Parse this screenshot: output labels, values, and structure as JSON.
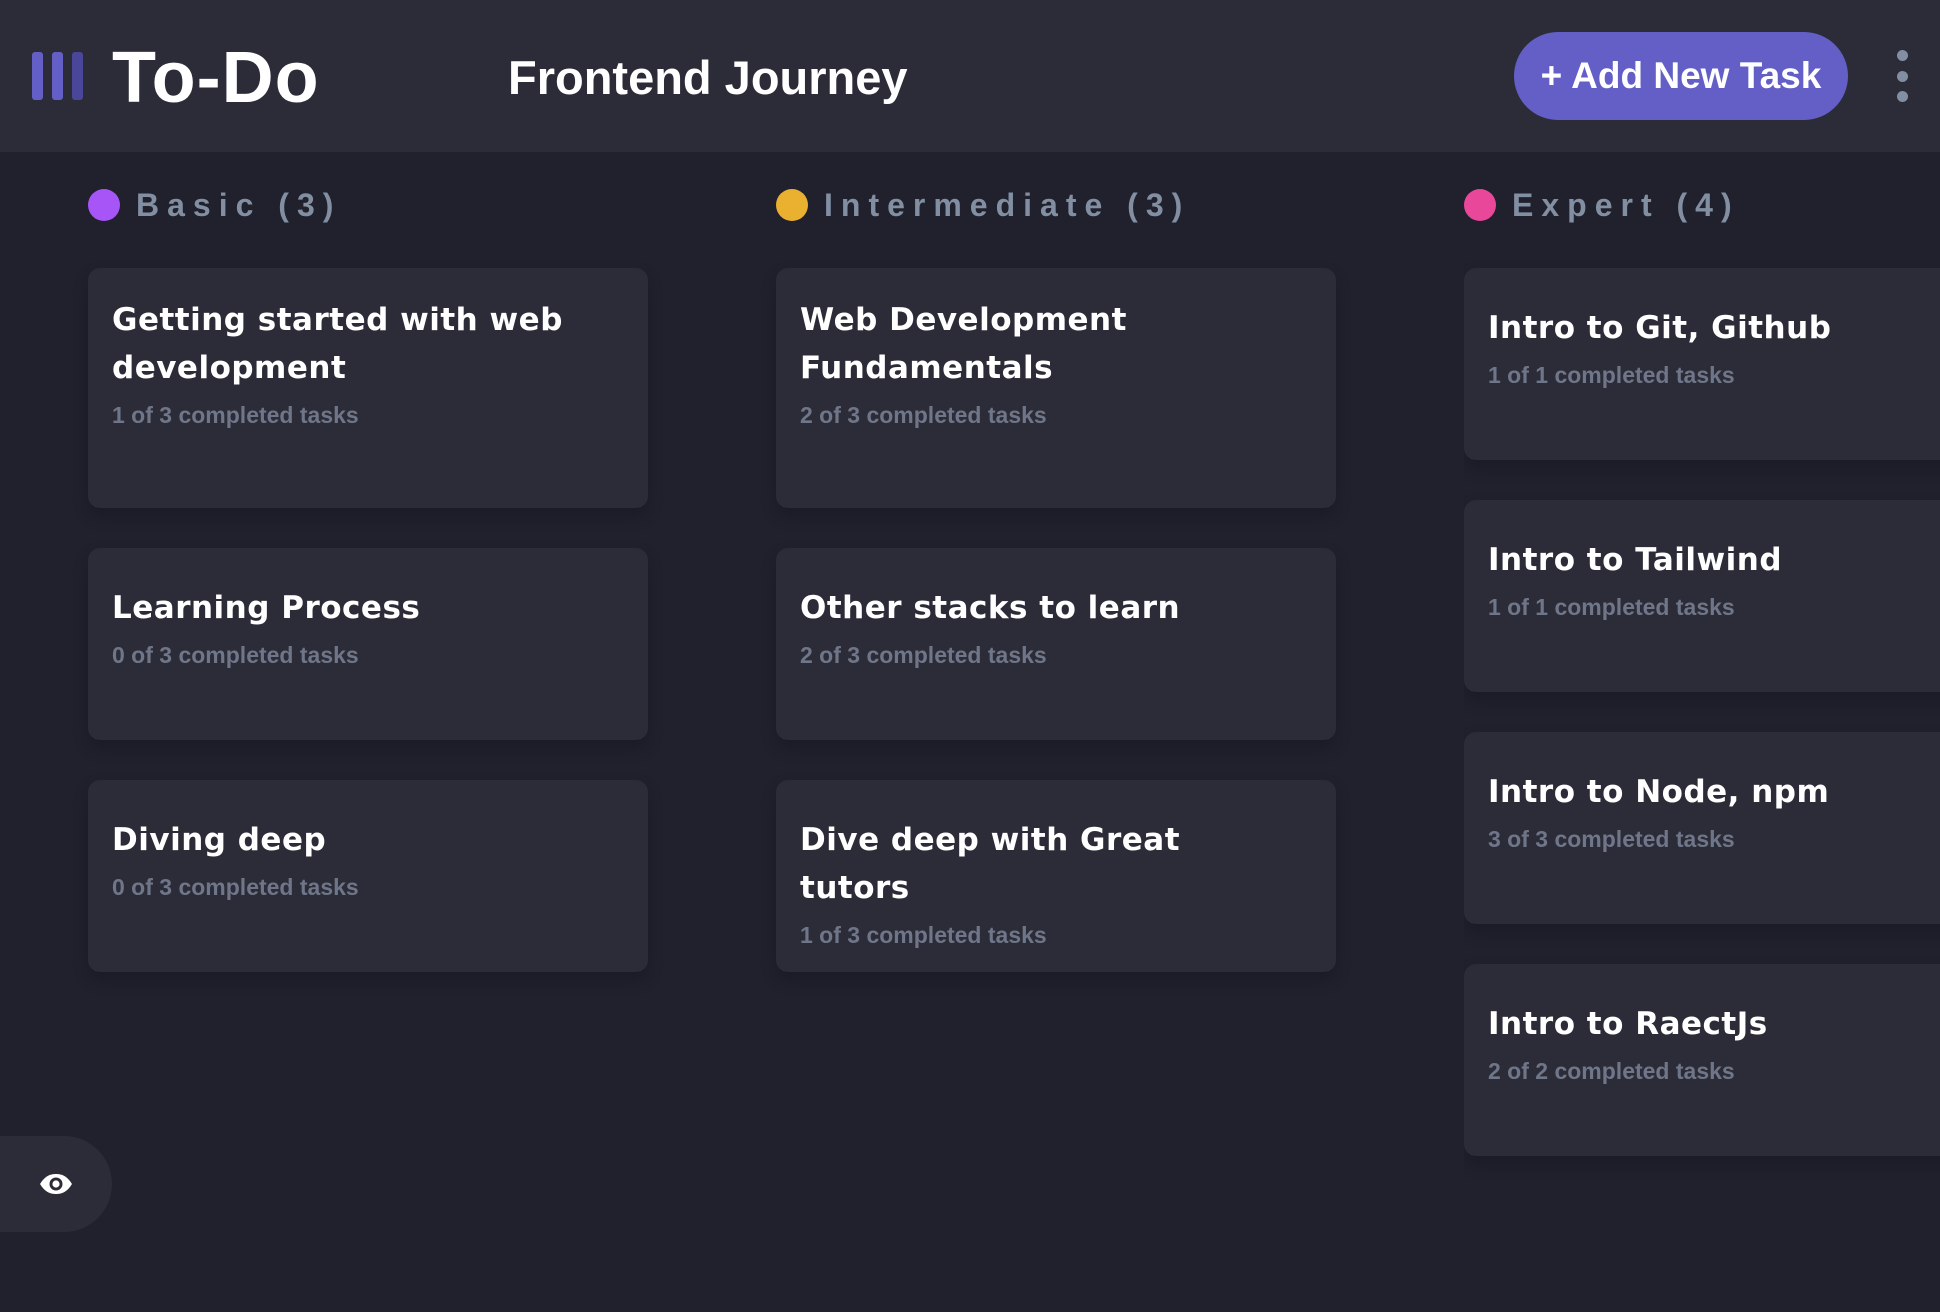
{
  "header": {
    "app_name": "To-Do",
    "board_title": "Frontend Journey",
    "add_task_label": "+ Add New Task",
    "logo_colors": [
      "#635fc7",
      "#635fc7",
      "#4a479a"
    ]
  },
  "columns": [
    {
      "label": "Basic (3)",
      "dot_color": "#a855f7",
      "tasks": [
        {
          "title": "Getting started with web development",
          "subtitle": "1 of 3 completed tasks"
        },
        {
          "title": "Learning Process",
          "subtitle": "0 of 3 completed tasks"
        },
        {
          "title": "Diving deep",
          "subtitle": "0 of 3 completed tasks"
        }
      ]
    },
    {
      "label": "Intermediate (3)",
      "dot_color": "#eab030",
      "tasks": [
        {
          "title": "Web Development Fundamentals",
          "subtitle": "2 of 3 completed tasks"
        },
        {
          "title": "Other stacks to learn",
          "subtitle": "2 of 3 completed tasks"
        },
        {
          "title": "Dive deep with Great tutors",
          "subtitle": "1 of 3 completed tasks"
        }
      ]
    },
    {
      "label": "Expert (4)",
      "dot_color": "#e8479a",
      "tasks": [
        {
          "title": "Intro to Git, Github",
          "subtitle": "1 of 1 completed tasks"
        },
        {
          "title": "Intro to Tailwind",
          "subtitle": "1 of 1 completed tasks"
        },
        {
          "title": "Intro to Node, npm",
          "subtitle": "3 of 3 completed tasks"
        },
        {
          "title": "Intro to RaectJs",
          "subtitle": "2 of 2 completed tasks"
        }
      ]
    }
  ],
  "sidebar_toggle": {
    "icon": "eye-icon"
  }
}
